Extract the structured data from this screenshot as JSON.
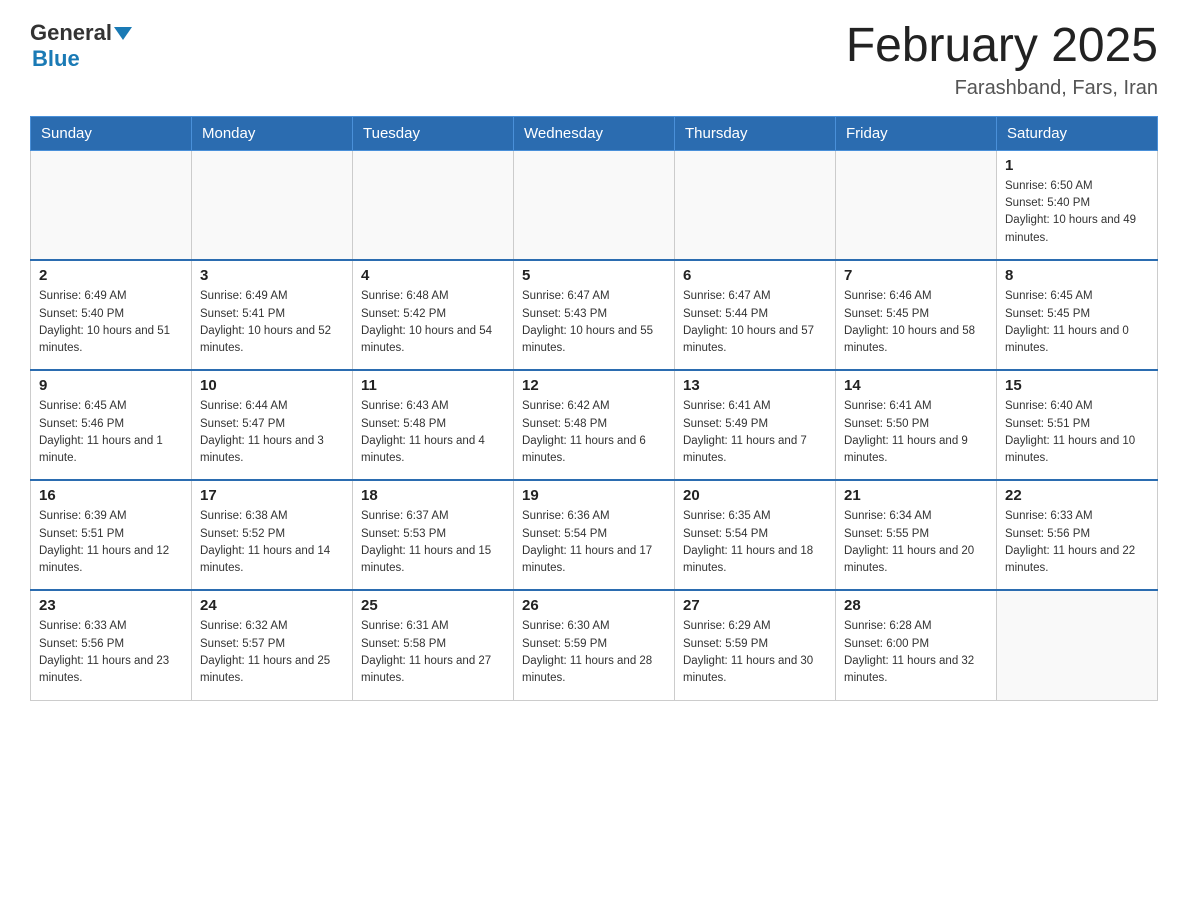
{
  "header": {
    "logo_general": "General",
    "logo_blue": "Blue",
    "month_title": "February 2025",
    "location": "Farashband, Fars, Iran"
  },
  "days_of_week": [
    "Sunday",
    "Monday",
    "Tuesday",
    "Wednesday",
    "Thursday",
    "Friday",
    "Saturday"
  ],
  "weeks": [
    [
      {
        "day": "",
        "sunrise": "",
        "sunset": "",
        "daylight": ""
      },
      {
        "day": "",
        "sunrise": "",
        "sunset": "",
        "daylight": ""
      },
      {
        "day": "",
        "sunrise": "",
        "sunset": "",
        "daylight": ""
      },
      {
        "day": "",
        "sunrise": "",
        "sunset": "",
        "daylight": ""
      },
      {
        "day": "",
        "sunrise": "",
        "sunset": "",
        "daylight": ""
      },
      {
        "day": "",
        "sunrise": "",
        "sunset": "",
        "daylight": ""
      },
      {
        "day": "1",
        "sunrise": "Sunrise: 6:50 AM",
        "sunset": "Sunset: 5:40 PM",
        "daylight": "Daylight: 10 hours and 49 minutes."
      }
    ],
    [
      {
        "day": "2",
        "sunrise": "Sunrise: 6:49 AM",
        "sunset": "Sunset: 5:40 PM",
        "daylight": "Daylight: 10 hours and 51 minutes."
      },
      {
        "day": "3",
        "sunrise": "Sunrise: 6:49 AM",
        "sunset": "Sunset: 5:41 PM",
        "daylight": "Daylight: 10 hours and 52 minutes."
      },
      {
        "day": "4",
        "sunrise": "Sunrise: 6:48 AM",
        "sunset": "Sunset: 5:42 PM",
        "daylight": "Daylight: 10 hours and 54 minutes."
      },
      {
        "day": "5",
        "sunrise": "Sunrise: 6:47 AM",
        "sunset": "Sunset: 5:43 PM",
        "daylight": "Daylight: 10 hours and 55 minutes."
      },
      {
        "day": "6",
        "sunrise": "Sunrise: 6:47 AM",
        "sunset": "Sunset: 5:44 PM",
        "daylight": "Daylight: 10 hours and 57 minutes."
      },
      {
        "day": "7",
        "sunrise": "Sunrise: 6:46 AM",
        "sunset": "Sunset: 5:45 PM",
        "daylight": "Daylight: 10 hours and 58 minutes."
      },
      {
        "day": "8",
        "sunrise": "Sunrise: 6:45 AM",
        "sunset": "Sunset: 5:45 PM",
        "daylight": "Daylight: 11 hours and 0 minutes."
      }
    ],
    [
      {
        "day": "9",
        "sunrise": "Sunrise: 6:45 AM",
        "sunset": "Sunset: 5:46 PM",
        "daylight": "Daylight: 11 hours and 1 minute."
      },
      {
        "day": "10",
        "sunrise": "Sunrise: 6:44 AM",
        "sunset": "Sunset: 5:47 PM",
        "daylight": "Daylight: 11 hours and 3 minutes."
      },
      {
        "day": "11",
        "sunrise": "Sunrise: 6:43 AM",
        "sunset": "Sunset: 5:48 PM",
        "daylight": "Daylight: 11 hours and 4 minutes."
      },
      {
        "day": "12",
        "sunrise": "Sunrise: 6:42 AM",
        "sunset": "Sunset: 5:48 PM",
        "daylight": "Daylight: 11 hours and 6 minutes."
      },
      {
        "day": "13",
        "sunrise": "Sunrise: 6:41 AM",
        "sunset": "Sunset: 5:49 PM",
        "daylight": "Daylight: 11 hours and 7 minutes."
      },
      {
        "day": "14",
        "sunrise": "Sunrise: 6:41 AM",
        "sunset": "Sunset: 5:50 PM",
        "daylight": "Daylight: 11 hours and 9 minutes."
      },
      {
        "day": "15",
        "sunrise": "Sunrise: 6:40 AM",
        "sunset": "Sunset: 5:51 PM",
        "daylight": "Daylight: 11 hours and 10 minutes."
      }
    ],
    [
      {
        "day": "16",
        "sunrise": "Sunrise: 6:39 AM",
        "sunset": "Sunset: 5:51 PM",
        "daylight": "Daylight: 11 hours and 12 minutes."
      },
      {
        "day": "17",
        "sunrise": "Sunrise: 6:38 AM",
        "sunset": "Sunset: 5:52 PM",
        "daylight": "Daylight: 11 hours and 14 minutes."
      },
      {
        "day": "18",
        "sunrise": "Sunrise: 6:37 AM",
        "sunset": "Sunset: 5:53 PM",
        "daylight": "Daylight: 11 hours and 15 minutes."
      },
      {
        "day": "19",
        "sunrise": "Sunrise: 6:36 AM",
        "sunset": "Sunset: 5:54 PM",
        "daylight": "Daylight: 11 hours and 17 minutes."
      },
      {
        "day": "20",
        "sunrise": "Sunrise: 6:35 AM",
        "sunset": "Sunset: 5:54 PM",
        "daylight": "Daylight: 11 hours and 18 minutes."
      },
      {
        "day": "21",
        "sunrise": "Sunrise: 6:34 AM",
        "sunset": "Sunset: 5:55 PM",
        "daylight": "Daylight: 11 hours and 20 minutes."
      },
      {
        "day": "22",
        "sunrise": "Sunrise: 6:33 AM",
        "sunset": "Sunset: 5:56 PM",
        "daylight": "Daylight: 11 hours and 22 minutes."
      }
    ],
    [
      {
        "day": "23",
        "sunrise": "Sunrise: 6:33 AM",
        "sunset": "Sunset: 5:56 PM",
        "daylight": "Daylight: 11 hours and 23 minutes."
      },
      {
        "day": "24",
        "sunrise": "Sunrise: 6:32 AM",
        "sunset": "Sunset: 5:57 PM",
        "daylight": "Daylight: 11 hours and 25 minutes."
      },
      {
        "day": "25",
        "sunrise": "Sunrise: 6:31 AM",
        "sunset": "Sunset: 5:58 PM",
        "daylight": "Daylight: 11 hours and 27 minutes."
      },
      {
        "day": "26",
        "sunrise": "Sunrise: 6:30 AM",
        "sunset": "Sunset: 5:59 PM",
        "daylight": "Daylight: 11 hours and 28 minutes."
      },
      {
        "day": "27",
        "sunrise": "Sunrise: 6:29 AM",
        "sunset": "Sunset: 5:59 PM",
        "daylight": "Daylight: 11 hours and 30 minutes."
      },
      {
        "day": "28",
        "sunrise": "Sunrise: 6:28 AM",
        "sunset": "Sunset: 6:00 PM",
        "daylight": "Daylight: 11 hours and 32 minutes."
      },
      {
        "day": "",
        "sunrise": "",
        "sunset": "",
        "daylight": ""
      }
    ]
  ]
}
